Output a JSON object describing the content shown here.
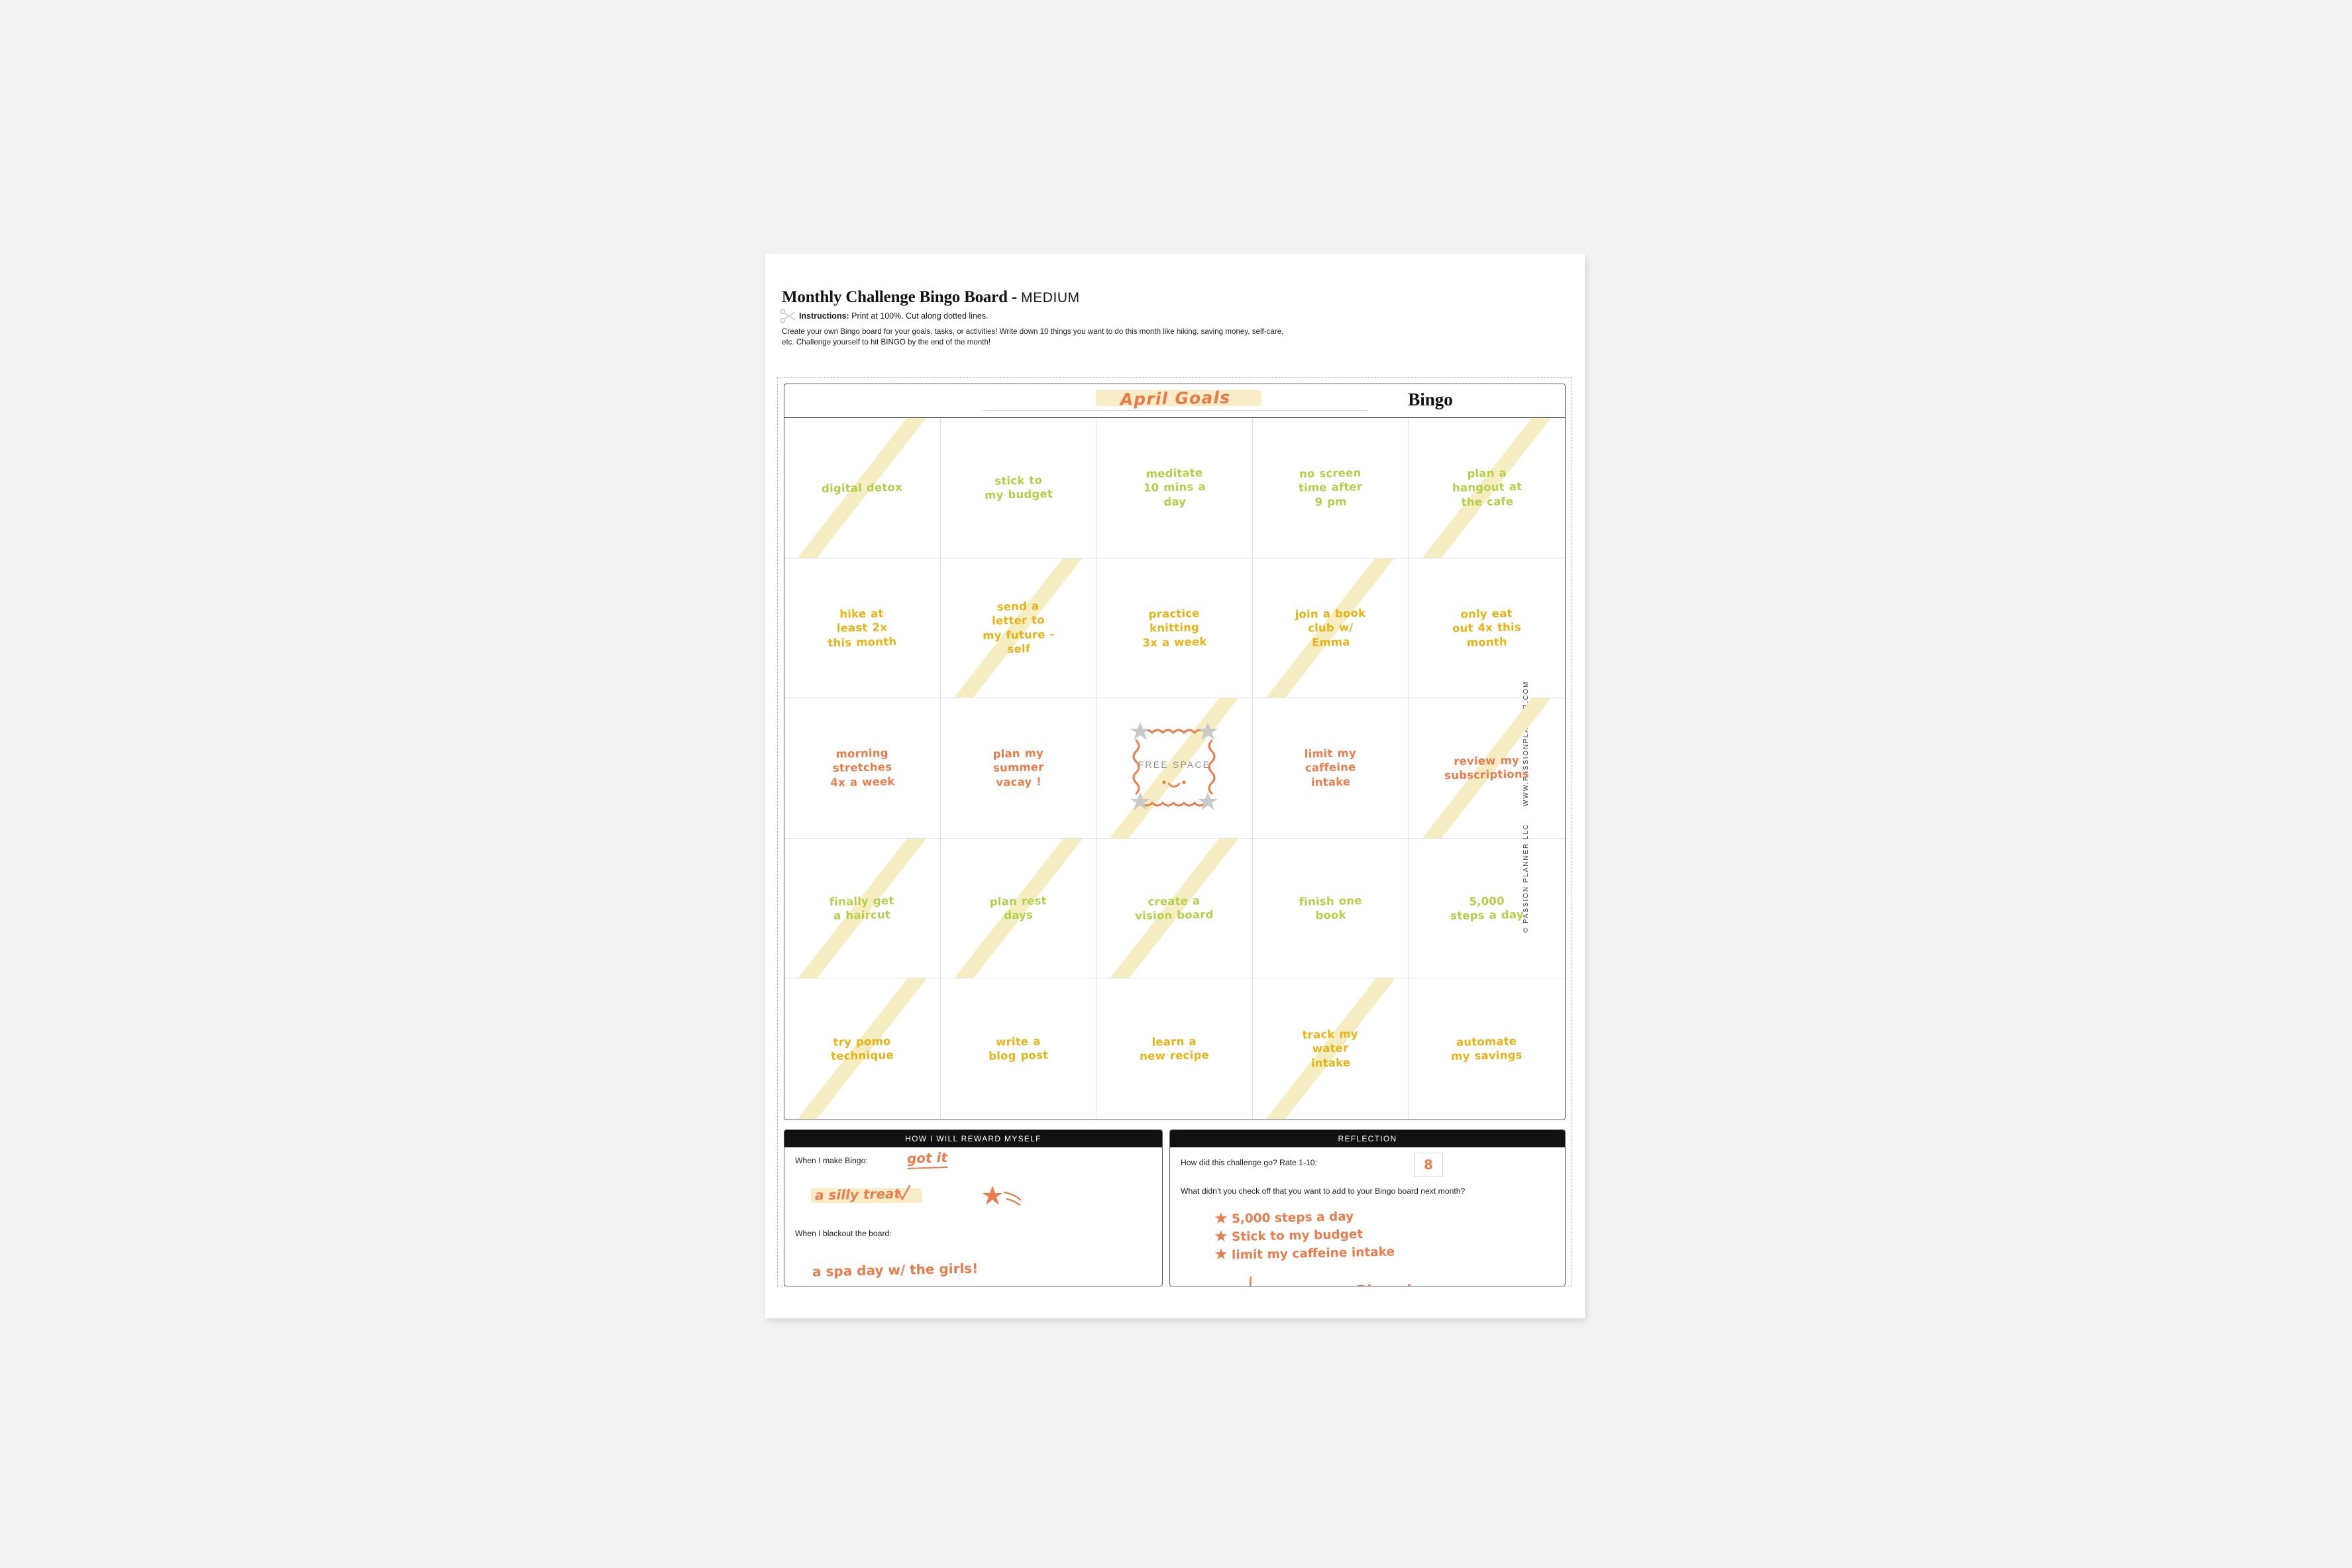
{
  "header": {
    "title_main": "Monthly Challenge Bingo Board",
    "title_sep": " - ",
    "title_size": "MEDIUM",
    "instructions_bold": "Instructions:",
    "instructions_rest": " Print at 100%. Cut along dotted lines.",
    "blurb": "Create your own Bingo board for your goals, tasks, or activities! Write down 10 things you want to do this month like hiking, saving money, self-care, etc. Challenge yourself to hit BINGO by the end of the month!",
    "scissors_icon": "scissors-icon"
  },
  "card": {
    "month_label": "April Goals",
    "bingo_label": "Bingo",
    "free_space_label": "FREE SPACE",
    "cells": [
      {
        "text": "digital detox",
        "color": "green",
        "struck": true
      },
      {
        "text": "stick to\nmy budget",
        "color": "green",
        "struck": false
      },
      {
        "text": "meditate\n10 mins a\nday",
        "color": "green",
        "struck": false
      },
      {
        "text": "no screen\ntime after\n9 pm",
        "color": "green",
        "struck": false
      },
      {
        "text": "plan a\nhangout at\nthe cafe",
        "color": "green",
        "struck": true
      },
      {
        "text": "hike at\nleast 2x\nthis month",
        "color": "yellow",
        "struck": false
      },
      {
        "text": "send a\nletter to\nmy future -\nself",
        "color": "yellow",
        "struck": true
      },
      {
        "text": "practice\nknitting\n3x a week",
        "color": "yellow",
        "struck": false
      },
      {
        "text": "join a book\nclub w/\nEmma",
        "color": "yellow",
        "struck": true
      },
      {
        "text": "only eat\nout 4x this\nmonth",
        "color": "yellow",
        "struck": false
      },
      {
        "text": "morning\nstretches\n4x a week",
        "color": "orange",
        "struck": false
      },
      {
        "text": "plan my\nsummer\nvacay !",
        "color": "orange",
        "struck": false
      },
      {
        "text": "FREE SPACE",
        "color": "free",
        "struck": true
      },
      {
        "text": "limit my\ncaffeine\nintake",
        "color": "orange",
        "struck": false
      },
      {
        "text": "review my\nsubscriptions",
        "color": "orange",
        "struck": true
      },
      {
        "text": "finally get\na haircut",
        "color": "green",
        "struck": true
      },
      {
        "text": "plan rest\ndays",
        "color": "green",
        "struck": true
      },
      {
        "text": "create a\nvision board",
        "color": "green",
        "struck": true
      },
      {
        "text": "finish one\nbook",
        "color": "green",
        "struck": false
      },
      {
        "text": "5,000\nsteps a day",
        "color": "green",
        "struck": false
      },
      {
        "text": "try pomo\ntechnique",
        "color": "yellow",
        "struck": true
      },
      {
        "text": "write a\nblog post",
        "color": "yellow",
        "struck": false
      },
      {
        "text": "learn a\nnew recipe",
        "color": "yellow",
        "struck": false
      },
      {
        "text": "track my\nwater\nintake",
        "color": "yellow",
        "struck": true
      },
      {
        "text": "automate\nmy savings",
        "color": "yellow",
        "struck": false
      }
    ]
  },
  "reward_panel": {
    "heading": "HOW I WILL REWARD MYSELF",
    "q1": "When I make Bingo:",
    "a1": "a silly treat",
    "a1_note": "got it",
    "q2": "When I blackout the board:",
    "a2": "a spa day w/ the girls!"
  },
  "reflection_panel": {
    "heading": "REFLECTION",
    "q1": "How did this challenge go? Rate 1-10:",
    "rating": "8",
    "q2": "What didn’t you check off that you want to add to your Bingo board next month?",
    "items": [
      "5,000 steps a day",
      "Stick to my budget",
      "limit my caffeine intake"
    ],
    "closing_note": "May Bingo !"
  },
  "footer": {
    "copyright": "© PASSION PLANNER LLC",
    "website": "WWW.PASSIONPLANNER.COM"
  },
  "colors": {
    "green": "#b4cf49",
    "yellow": "#e6b417",
    "orange": "#e87d4d",
    "highlighter": "#f7edc3",
    "ink_black": "#111111",
    "paper": "#ffffff",
    "backdrop": "#f2f2f2"
  }
}
